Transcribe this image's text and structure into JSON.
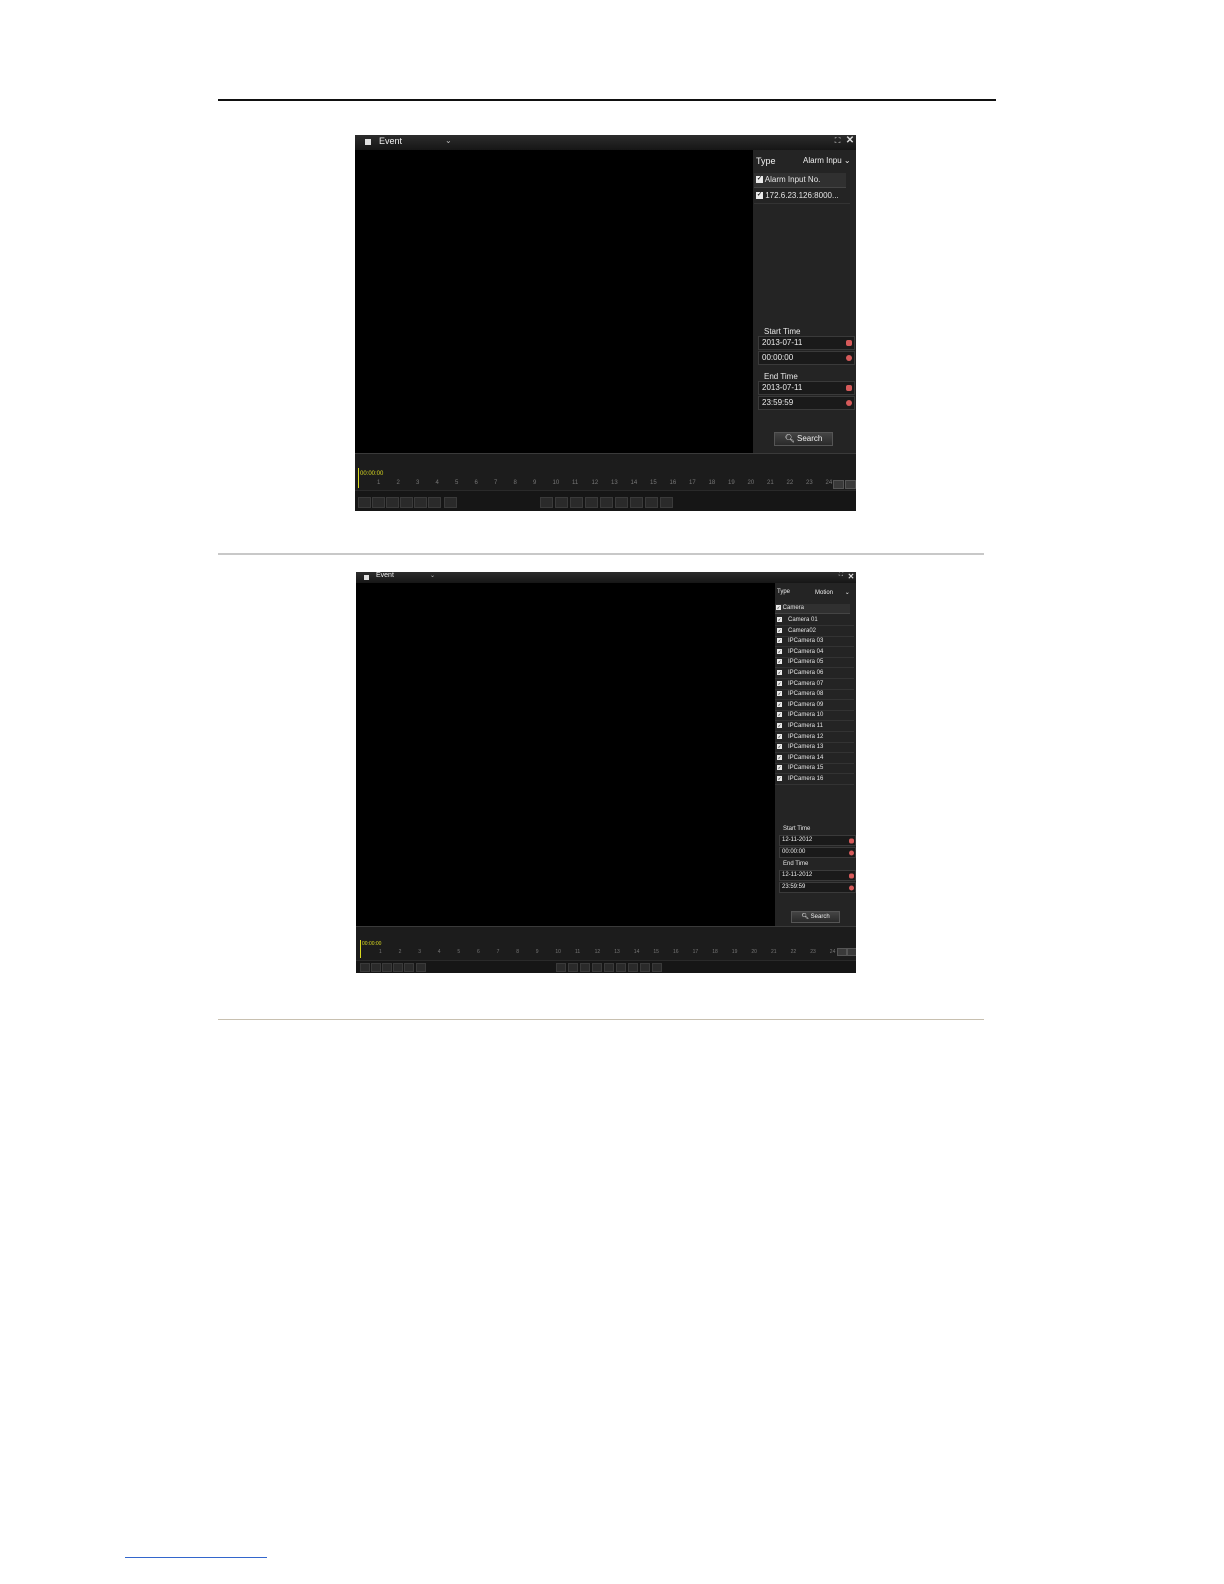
{
  "shot1": {
    "title": "Event",
    "type_label": "Type",
    "type_value": "Alarm Inpu",
    "list_header": "Alarm Input No.",
    "list_items": [
      "172.6.23.126:8000..."
    ],
    "start_label": "Start Time",
    "start_date": "2013-07-11",
    "start_time": "00:00:00",
    "end_label": "End Time",
    "end_date": "2013-07-11",
    "end_time": "23:59:59",
    "search_label": "Search",
    "timeline_time": "00:00:00",
    "ticks": [
      "1",
      "2",
      "3",
      "4",
      "5",
      "6",
      "7",
      "8",
      "9",
      "10",
      "11",
      "12",
      "13",
      "14",
      "15",
      "16",
      "17",
      "18",
      "19",
      "20",
      "21",
      "22",
      "23",
      "24"
    ]
  },
  "shot2": {
    "title": "Event",
    "type_label": "Type",
    "type_value": "Motion",
    "list_header": "Camera",
    "list_items": [
      "Camera 01",
      "Camera02",
      "IPCamera 03",
      "IPCamera 04",
      "IPCamera 05",
      "IPCamera 06",
      "IPCamera 07",
      "IPCamera 08",
      "IPCamera 09",
      "IPCamera 10",
      "IPCamera 11",
      "IPCamera 12",
      "IPCamera 13",
      "IPCamera 14",
      "IPCamera 15",
      "IPCamera 16"
    ],
    "start_label": "Start Time",
    "start_date": "12-11-2012",
    "start_time": "00:00:00",
    "end_label": "End Time",
    "end_date": "12-11-2012",
    "end_time": "23:59:59",
    "search_label": "Search",
    "timeline_time": "00:00:00",
    "ticks": [
      "1",
      "2",
      "3",
      "4",
      "5",
      "6",
      "7",
      "8",
      "9",
      "10",
      "11",
      "12",
      "13",
      "14",
      "15",
      "16",
      "17",
      "18",
      "19",
      "20",
      "21",
      "22",
      "23",
      "24"
    ]
  },
  "icons": {
    "dropdown": "chevron-down-icon",
    "maximize": "maximize-icon",
    "close": "close-icon",
    "search": "search-icon",
    "calendar": "calendar-icon",
    "clock": "clock-icon",
    "checkbox": "checkbox-checked-icon"
  },
  "colors": {
    "background": "#141414",
    "panel": "#242424",
    "timeline_accent": "#d8d820",
    "calendar_icon": "#d65a5a"
  }
}
